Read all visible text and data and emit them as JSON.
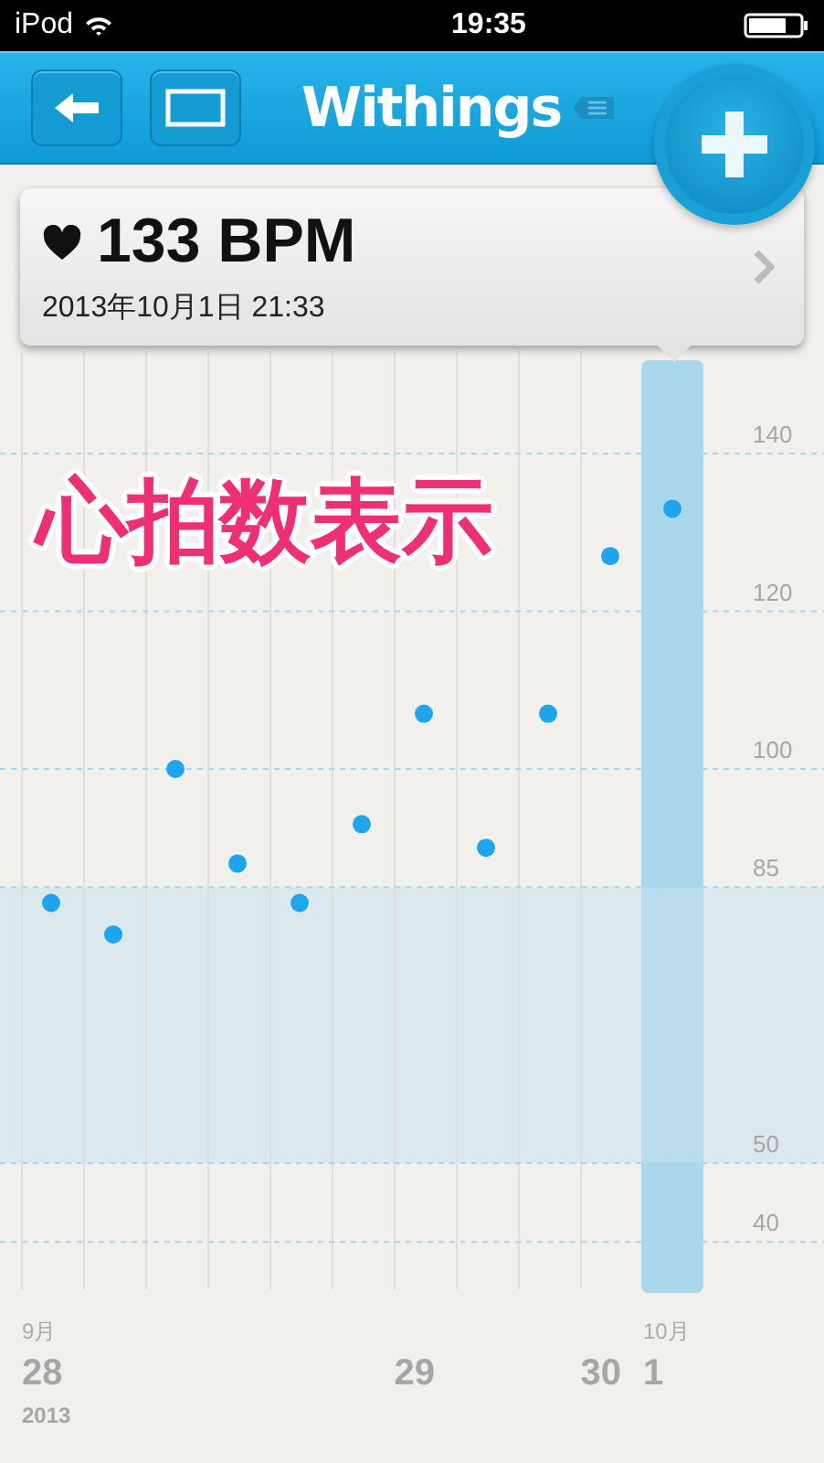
{
  "status_bar": {
    "device": "iPod",
    "time": "19:35"
  },
  "header": {
    "title": "Withings"
  },
  "reading": {
    "value": "133 BPM",
    "datetime": "2013年10月1日 21:33"
  },
  "caption": "心拍数表示",
  "chart": {
    "chart_data": {
      "type": "scatter",
      "categories": [
        "28",
        null,
        null,
        null,
        null,
        null,
        "29",
        null,
        null,
        "30",
        "1"
      ],
      "series": [
        {
          "color": "#1fa5ee",
          "values": [
            83,
            79,
            100,
            88,
            83,
            93,
            107,
            90,
            107,
            127,
            133
          ]
        }
      ],
      "ylim": [
        34,
        153
      ],
      "yticks": [
        40,
        50,
        85,
        100,
        120,
        140
      ],
      "grid": true,
      "bands": [
        {
          "axis": "y",
          "from": 50,
          "to": 85
        }
      ]
    },
    "columns": [
      {
        "selected": false
      },
      {
        "selected": false
      },
      {
        "selected": false
      },
      {
        "selected": false
      },
      {
        "selected": false
      },
      {
        "selected": false
      },
      {
        "selected": false
      },
      {
        "selected": false
      },
      {
        "selected": false
      },
      {
        "selected": false
      },
      {
        "selected": true
      }
    ],
    "month_labels": [
      "9月",
      "10月"
    ],
    "year_label": "2013"
  }
}
